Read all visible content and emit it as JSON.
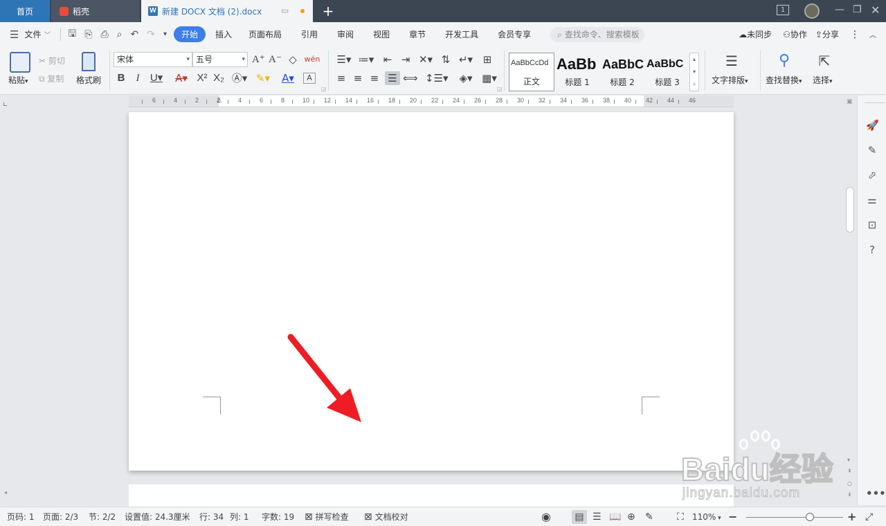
{
  "tabs": {
    "home": "首页",
    "daoke": "稻壳",
    "doc": "新建 DOCX 文档 (2).docx",
    "new_tab": "+"
  },
  "menu": {
    "file": "文件",
    "items": [
      "开始",
      "插入",
      "页面布局",
      "引用",
      "审阅",
      "视图",
      "章节",
      "开发工具",
      "会员专享"
    ],
    "search_placeholder": "查找命令、搜索模板",
    "unsync": "未同步",
    "collab": "协作",
    "share": "分享"
  },
  "ribbon": {
    "paste": "粘贴",
    "cut": "剪切",
    "copy": "复制",
    "format_painter": "格式刷",
    "font_name": "宋体",
    "font_size": "五号",
    "styles": [
      {
        "preview": "AaBbCcDd",
        "label": "正文"
      },
      {
        "preview": "AaBb",
        "label": "标题 1"
      },
      {
        "preview": "AaBbC",
        "label": "标题 2"
      },
      {
        "preview": "AaBbC",
        "label": "标题 3"
      }
    ],
    "text_layout": "文字排版",
    "find_replace": "查找替换",
    "select": "选择"
  },
  "ruler": {
    "ticks": [
      "6",
      "4",
      "2",
      "2",
      "4",
      "6",
      "8",
      "10",
      "12",
      "14",
      "16",
      "18",
      "20",
      "22",
      "24",
      "26",
      "28",
      "30",
      "32",
      "34",
      "36",
      "38",
      "40",
      "42",
      "44",
      "46"
    ]
  },
  "status": {
    "page_no": "页码: 1",
    "pages": "页面: 2/3",
    "section": "节: 2/2",
    "position": "设置值: 24.3厘米",
    "line": "行: 34",
    "column": "列: 1",
    "word_count": "字数: 19",
    "spell_check": "拼写检查",
    "doc_proof": "文档校对",
    "zoom": "110%",
    "zoom_level": 0.66
  },
  "watermark": {
    "brand": "Baidu经验",
    "url": "jingyan.baidu.com"
  },
  "colors": {
    "tabbar": "#3c4653",
    "accent": "#3d7ee8",
    "arrow": "#ee1d23"
  }
}
